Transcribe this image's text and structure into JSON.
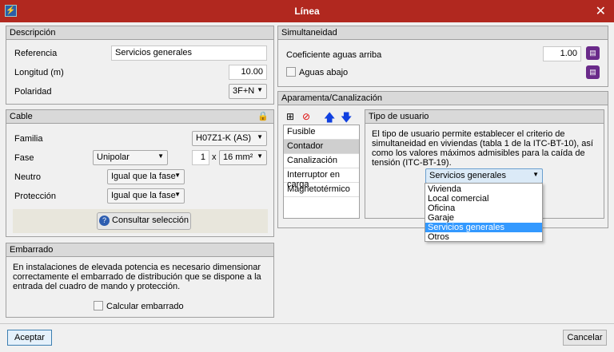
{
  "window": {
    "title": "Línea"
  },
  "descripcion": {
    "header": "Descripción",
    "referencia_label": "Referencia",
    "referencia_value": "Servicios generales",
    "longitud_label": "Longitud (m)",
    "longitud_value": "10.00",
    "polaridad_label": "Polaridad",
    "polaridad_value": "3F+N"
  },
  "cable": {
    "header": "Cable",
    "familia_label": "Familia",
    "familia_value": "H07Z1-K (AS)",
    "fase_label": "Fase",
    "fase_type": "Unipolar",
    "fase_count": "1",
    "fase_x": "x",
    "fase_section": "16 mm²",
    "neutro_label": "Neutro",
    "neutro_value": "Igual que la fase",
    "proteccion_label": "Protección",
    "proteccion_value": "Igual que la fase",
    "consultar_label": "Consultar selección"
  },
  "embarrado": {
    "header": "Embarrado",
    "text": "En instalaciones de elevada potencia es necesario dimensionar correctamente el embarrado de distribución que se dispone a la entrada del cuadro de mando y protección.",
    "calcular_label": "Calcular embarrado"
  },
  "simultaneidad": {
    "header": "Simultaneidad",
    "coef_label": "Coeficiente aguas arriba",
    "coef_value": "1.00",
    "aguas_abajo_label": "Aguas abajo"
  },
  "aparamenta": {
    "header": "Aparamenta/Canalización",
    "items": [
      "Fusible",
      "Contador",
      "Canalización",
      "Interruptor en carga",
      "Magnetotérmico"
    ],
    "selected": "Contador"
  },
  "tipo_usuario": {
    "header": "Tipo de usuario",
    "text": "El tipo de usuario permite establecer el criterio de simultaneidad en viviendas (tabla 1 de la ITC-BT-10), así como los valores máximos admisibles para la caída de tensión (ITC-BT-19).",
    "value": "Servicios generales",
    "options": [
      "Vivienda",
      "Local comercial",
      "Oficina",
      "Garaje",
      "Servicios generales",
      "Otros"
    ]
  },
  "footer": {
    "accept": "Aceptar",
    "cancel": "Cancelar"
  },
  "colors": {
    "titlebar": "#b1281f",
    "highlight": "#3399ff"
  }
}
